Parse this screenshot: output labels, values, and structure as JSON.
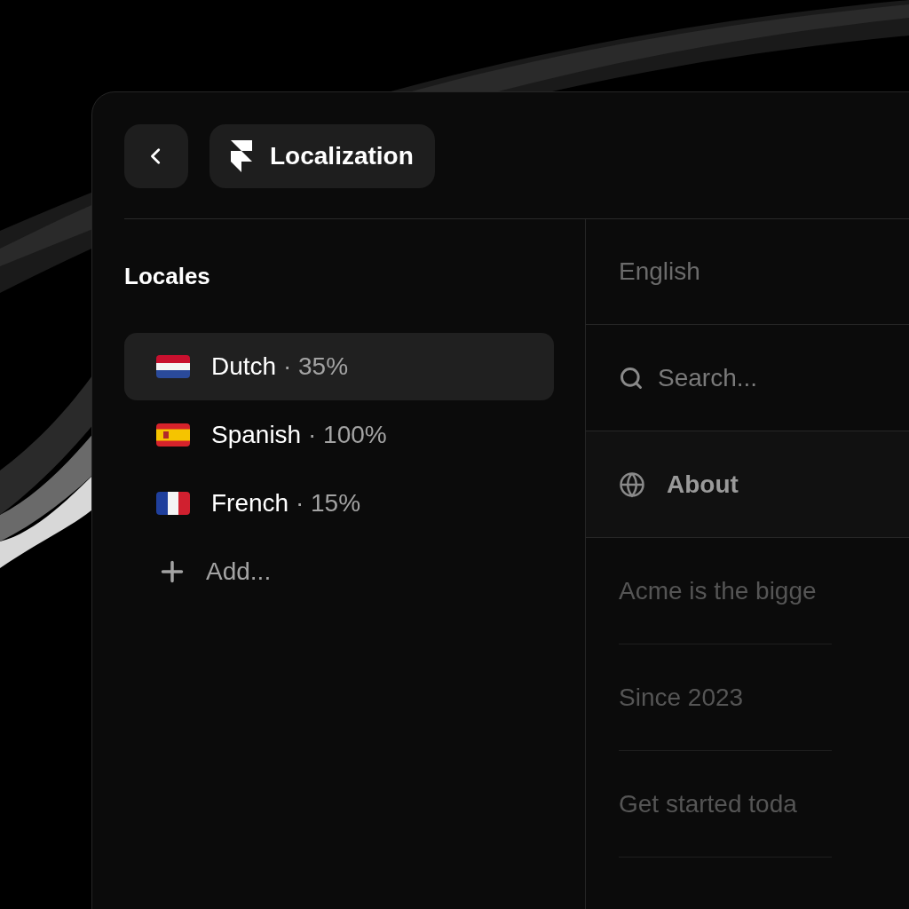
{
  "header": {
    "title": "Localization"
  },
  "locales": {
    "heading": "Locales",
    "items": [
      {
        "name": "Dutch",
        "detail": "· 35%",
        "kind": "nl",
        "selected": true
      },
      {
        "name": "Spanish",
        "detail": "· 100%",
        "kind": "es",
        "selected": false
      },
      {
        "name": "French",
        "detail": "· 15%",
        "kind": "fr",
        "selected": false
      }
    ],
    "add_label": "Add..."
  },
  "content": {
    "language": "English",
    "search": {
      "placeholder": "Search..."
    },
    "section": "About",
    "entries": [
      "Acme is the bigge",
      "Since 2023",
      "Get started toda"
    ]
  }
}
